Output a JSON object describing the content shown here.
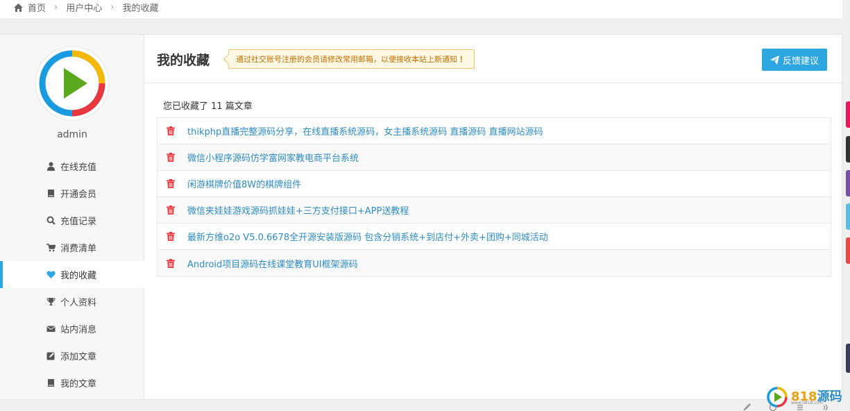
{
  "breadcrumb": {
    "home": "首页",
    "user_center": "用户中心",
    "current": "我的收藏"
  },
  "user": {
    "name": "admin"
  },
  "menu": [
    {
      "label": "在线充值",
      "icon": "user-icon"
    },
    {
      "label": "开通会员",
      "icon": "book-icon"
    },
    {
      "label": "充值记录",
      "icon": "search-icon"
    },
    {
      "label": "消费清单",
      "icon": "cart-icon"
    },
    {
      "label": "我的收藏",
      "icon": "heart-icon",
      "active": true
    },
    {
      "label": "个人资料",
      "icon": "trophy-icon"
    },
    {
      "label": "站内消息",
      "icon": "envelope-icon"
    },
    {
      "label": "添加文章",
      "icon": "edit-icon"
    },
    {
      "label": "我的文章",
      "icon": "book-icon"
    }
  ],
  "content": {
    "title": "我的收藏",
    "notice": "通过社交账号注册的会员请修改常用邮箱，以便接收本站上新通知",
    "notice_mark": "！",
    "feedback_label": "反馈建议",
    "count_text": "您已收藏了 11 篇文章",
    "favorites": [
      "thikphp直播完整源码分享，在线直播系统源码，女主播系统源码 直播源码 直播网站源码",
      "微信小程序源码仿学富网家教电商平台系统",
      "闲游棋牌价值8W的棋牌组件",
      "微信夹娃娃游戏源码抓娃娃+三方支付接口+APP送教程",
      "最新方维o2o V5.0.6678全开源安装版源码 包含分销系统+到店付+外卖+团购+同城活动",
      "Android项目源码在线课堂教育UI框架源码"
    ]
  },
  "brand": {
    "num": "818",
    "name": "源码",
    "url": "www.0818.com"
  },
  "colors": {
    "accent": "#2ea7e0",
    "link": "#2e8bc0",
    "danger": "#e8383d",
    "edge_tabs": [
      "#e8195b",
      "#333333",
      "#7b4fa8",
      "#5bc0de",
      "#e84a4a"
    ]
  }
}
